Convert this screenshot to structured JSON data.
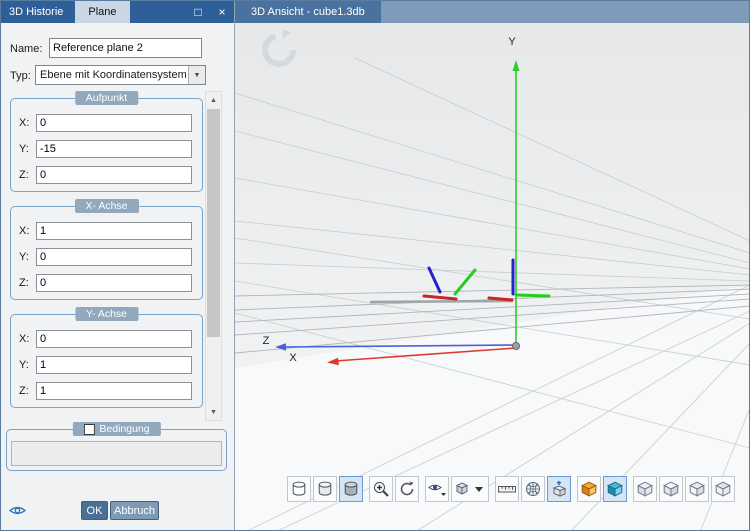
{
  "colors": {
    "titlebar_dark": "#2f5f98",
    "titlebar_light": "#7e9cba",
    "active_tab_bg": "#c9d6e4",
    "group_border": "#7aa3cc",
    "group_chip_bg": "#92a9bd",
    "axis_x": "#de3a2c",
    "axis_y": "#2ecc2e",
    "axis_z": "#4a62d8",
    "selected_toolbar_button_bg": "#d5e5f5"
  },
  "left_panel": {
    "tabs": [
      {
        "label": "3D Historie",
        "active": false
      },
      {
        "label": "Plane",
        "active": true
      }
    ],
    "window_buttons": {
      "maximize": "□",
      "close": "×"
    },
    "fields": {
      "name_label": "Name:",
      "name_value": "Reference plane 2",
      "type_label": "Typ:",
      "type_value": "Ebene mit Koordinatensystem",
      "type_caret": "▼"
    },
    "groups": [
      {
        "title": "Aufpunkt",
        "fields": [
          {
            "label": "X:",
            "value": "0"
          },
          {
            "label": "Y:",
            "value": "-15"
          },
          {
            "label": "Z:",
            "value": "0"
          }
        ]
      },
      {
        "title": "X- Achse",
        "fields": [
          {
            "label": "X:",
            "value": "1"
          },
          {
            "label": "Y:",
            "value": "0"
          },
          {
            "label": "Z:",
            "value": "0"
          }
        ]
      },
      {
        "title": "Y- Achse",
        "fields": [
          {
            "label": "X:",
            "value": "0"
          },
          {
            "label": "Y:",
            "value": "1"
          },
          {
            "label": "Z:",
            "value": "1"
          }
        ]
      }
    ],
    "scrollbar": {
      "up": "▲",
      "down": "▼"
    },
    "bedingung": {
      "title": "Bedingung",
      "checked": false,
      "field_value": ""
    },
    "footer": {
      "ok": "OK",
      "cancel": "Abbruch"
    }
  },
  "view_panel": {
    "tab_title": "3D Ansicht - cube1.3db",
    "axes": {
      "x": "X",
      "y": "Y",
      "z": "Z"
    },
    "toolbar": {
      "buttons": [
        {
          "icon": "cylinder-wireframe"
        },
        {
          "icon": "cylinder-hidden-edges"
        },
        {
          "icon": "cylinder-shaded",
          "selected": true
        },
        {
          "icon": "zoom-in",
          "group_start": true
        },
        {
          "icon": "orbit-view"
        },
        {
          "icon": "camera-view",
          "group_start": true
        },
        {
          "icon": "view-preset-combo",
          "wide": true
        },
        {
          "icon": "ruler-measure",
          "group_start": true
        },
        {
          "icon": "mesh-display"
        },
        {
          "icon": "move-view",
          "selected": true
        },
        {
          "icon": "cube-solid-orange",
          "group_start": true
        },
        {
          "icon": "cube-solid-blue",
          "selected": true
        },
        {
          "icon": "cube-view-iso",
          "group_start": true
        },
        {
          "icon": "cube-view-front"
        },
        {
          "icon": "cube-view-side"
        },
        {
          "icon": "cube-view-back"
        }
      ]
    }
  }
}
